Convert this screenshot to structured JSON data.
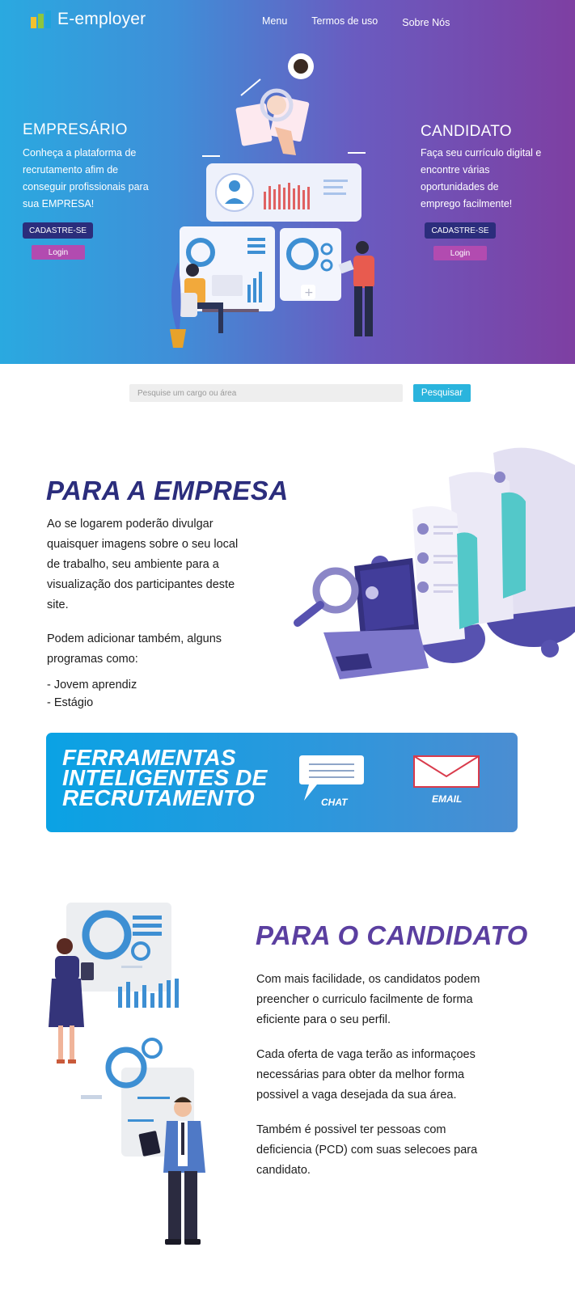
{
  "brand": {
    "name": "E-employer",
    "logo_colors": [
      "#f2c12e",
      "#8cc63f",
      "#1fa3dc"
    ]
  },
  "nav": {
    "items": [
      "Menu",
      "Termos de uso",
      "Sobre Nós"
    ]
  },
  "empresario": {
    "title": "EMPRESÁRIO",
    "text_lines": [
      "Conheça a plataforma de",
      "recrutamento afim de",
      "conseguir profissionais para",
      "sua EMPRESA!"
    ],
    "signup_label": "CADASTRE-SE",
    "login_label": "Login"
  },
  "candidato_hero": {
    "title": "CANDIDATO",
    "text_lines": [
      "Faça seu currículo digital e",
      "encontre várias",
      "oportunidades de",
      "emprego facilmente!"
    ],
    "signup_label": "CADASTRE-SE",
    "login_label": "Login"
  },
  "search": {
    "placeholder": "Pesquise um cargo ou área",
    "button_label": "Pesquisar"
  },
  "empresa_section": {
    "heading": "PARA A EMPRESA",
    "paragraph1": [
      "Ao se logarem poderão divulgar",
      "quaisquer imagens sobre o seu local",
      "de trabalho, seu ambiente para a",
      "visualização dos participantes deste",
      "site."
    ],
    "paragraph2": [
      "Podem adicionar também, alguns",
      "programas como:"
    ],
    "list": [
      "- Jovem aprendiz",
      "- Estágio"
    ]
  },
  "banner": {
    "title_lines": [
      "FERRAMENTAS",
      "INTELIGENTES DE",
      "RECRUTAMENTO"
    ],
    "chat_label": "CHAT",
    "email_label": "EMAIL"
  },
  "candidato_section": {
    "heading": "PARA O CANDIDATO",
    "paragraph1": [
      "Com mais facilidade, os candidatos podem",
      "preencher o curriculo facilmente de forma",
      "eficiente para o seu perfil."
    ],
    "paragraph2": [
      "Cada oferta de vaga terão as informaçoes",
      "necessárias para obter da melhor forma",
      "possivel a vaga desejada da sua área."
    ],
    "paragraph3": [
      "Também é possivel ter pessoas com",
      "deficiencia (PCD) com suas selecoes para",
      "candidato."
    ]
  },
  "colors": {
    "navy": "#2b2d7c",
    "purple": "#5b3fa0",
    "pink_button": "#b24bb0",
    "search_button": "#2ab4dd",
    "hero_gradient": [
      "#2aa9e0",
      "#7e3fa2"
    ]
  }
}
